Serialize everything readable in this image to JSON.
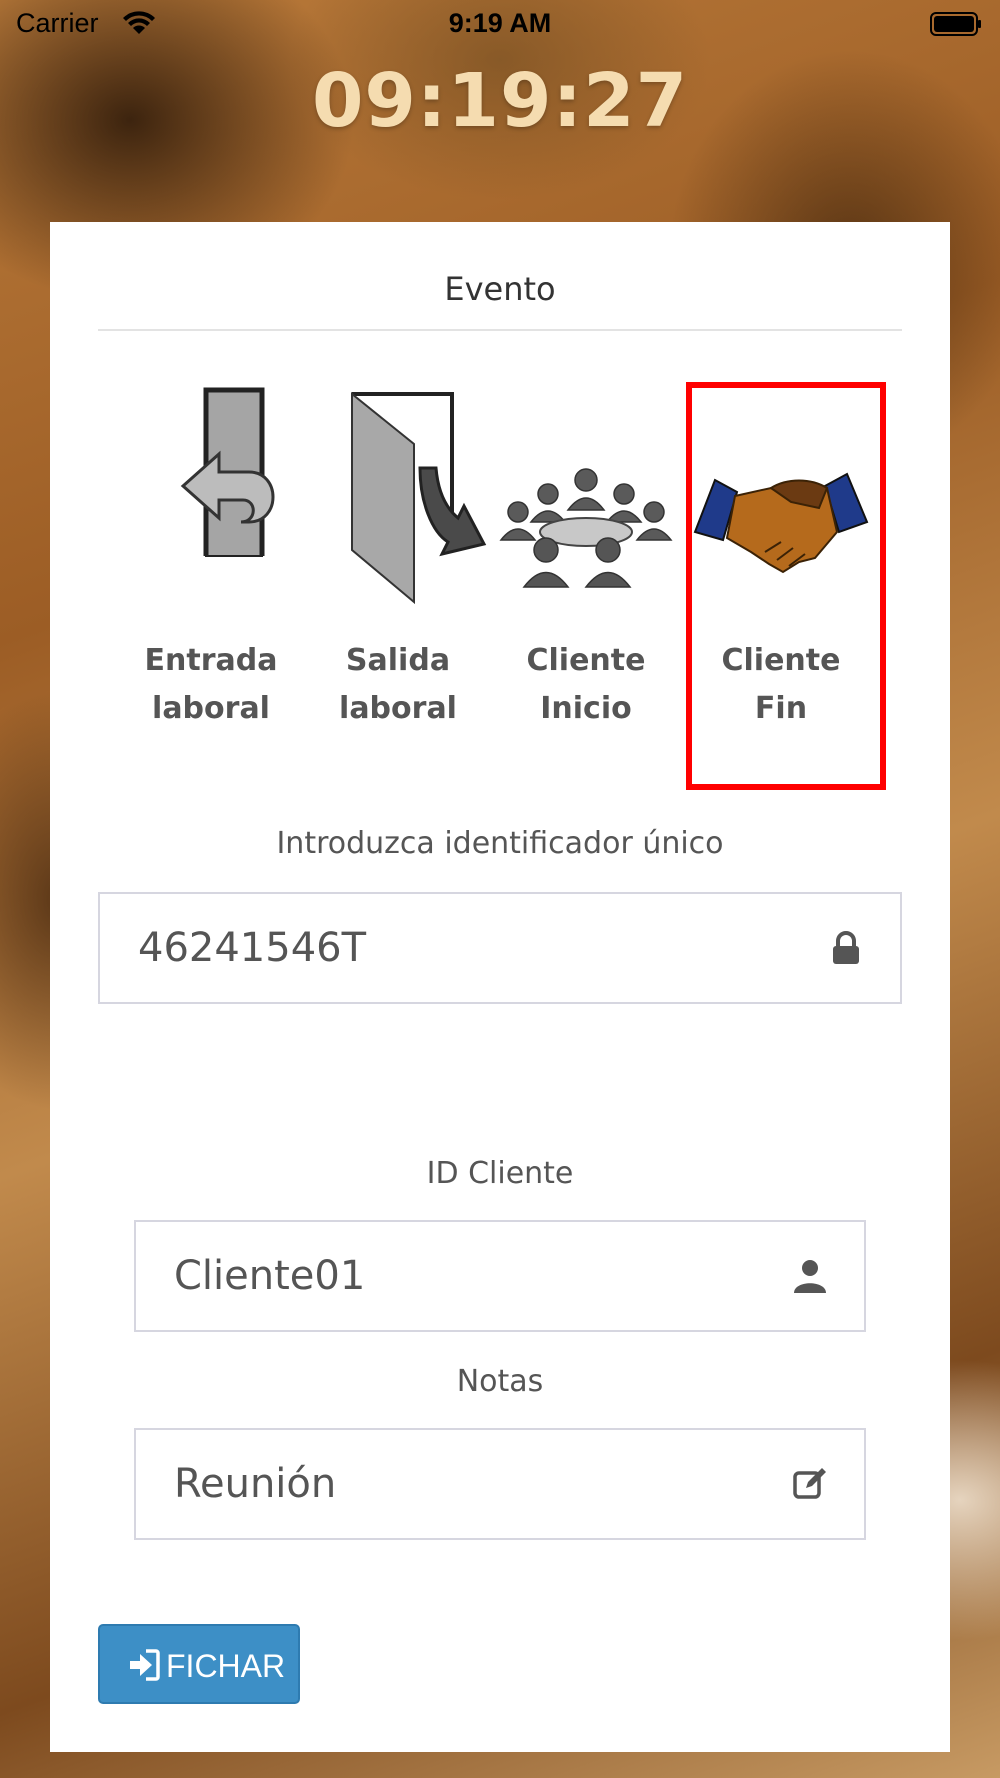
{
  "status_bar": {
    "carrier": "Carrier",
    "time": "9:19 AM"
  },
  "clock": "09:19:27",
  "section_title": "Evento",
  "events": [
    {
      "label": "Entrada\nlaboral",
      "icon": "door-enter-icon"
    },
    {
      "label": "Salida\nlaboral",
      "icon": "door-exit-icon"
    },
    {
      "label": "Cliente\nInicio",
      "icon": "meeting-icon"
    },
    {
      "label": "Cliente\nFin",
      "icon": "handshake-icon",
      "selected": true
    }
  ],
  "identifier": {
    "label": "Introduzca identificador único",
    "value": "46241546T",
    "icon": "lock-icon"
  },
  "client_id": {
    "label": "ID Cliente",
    "value": "Cliente01",
    "icon": "user-icon"
  },
  "notes": {
    "label": "Notas",
    "value": "Reunión",
    "icon": "edit-icon"
  },
  "submit": {
    "label": "FICHAR",
    "icon": "sign-in-icon"
  },
  "colors": {
    "selection": "#ff0000",
    "button": "#3d8fc6",
    "clock": "#f5dcb0"
  }
}
